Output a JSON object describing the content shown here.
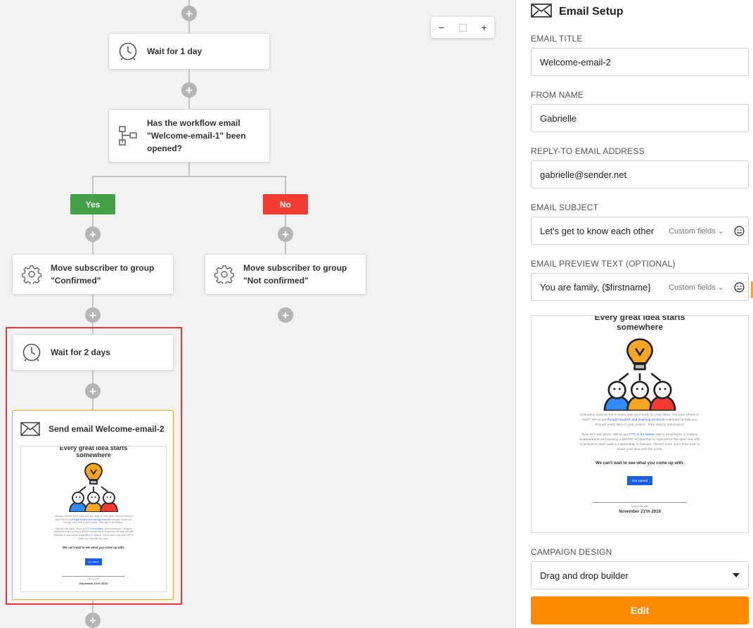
{
  "canvas": {
    "zoom_controls": {
      "minus": "−",
      "plus": "+"
    },
    "nodes": {
      "wait1": "Wait for 1 day",
      "condition": "Has the workflow email \"Welcome-email-1\" been opened?",
      "move_yes": "Move subscriber to group \"Confirmed\"",
      "move_no": "Move subscriber to group \"Not confirmed\"",
      "wait2": "Wait for 2 days",
      "send_email": "Send email Welcome-email-2"
    },
    "branches": {
      "yes": "Yes",
      "no": "No"
    },
    "plus_symbol": "+"
  },
  "preview": {
    "title": "Every great idea starts somewhere",
    "body1_before": "Company Science list in under way and ready for your ideas. Not sure where to start? We've got ",
    "body1_link": "thought leaders and inspiring products",
    "body1_after": " examples to help you through every idea of your project - from start to submission.",
    "body2_before": "Now let's talk about. We've got ",
    "body2_link": "YTG to be stated",
    "body2_after": ". We're traveling to Company headquarters and winning a $50000 scholarship to experience the open sea with scientists or even added a spaceship in Mission. There's even more than ever to share your idea with the world.",
    "tagline": "We can't wait to see what you come up with.",
    "cta": "Get started",
    "footer_small": "Submit an idea",
    "date": "November 21'th 2019"
  },
  "panel": {
    "title": "Email Setup",
    "email_title": {
      "label": "EMAIL TITLE",
      "value": "Welcome-email-2"
    },
    "from_name": {
      "label": "FROM NAME",
      "value": "Gabrielle"
    },
    "reply_to": {
      "label": "REPLY-TO EMAIL ADDRESS",
      "value": "gabrielle@sender.net"
    },
    "subject": {
      "label": "EMAIL SUBJECT",
      "value": "Let's get to know each other",
      "custom_fields": "Custom fields"
    },
    "preview_text": {
      "label": "EMAIL PREVIEW TEXT (OPTIONAL)",
      "value": "You are family, {$firstname}",
      "custom_fields": "Custom fields"
    },
    "campaign_design": {
      "label": "CAMPAIGN DESIGN",
      "value": "Drag and drop builder"
    },
    "edit_button": "Edit"
  },
  "colors": {
    "yes": "#43a047",
    "no": "#f23b31",
    "accent": "#ff8a00",
    "highlight": "#e53935",
    "selected_border": "#f6a623"
  },
  "icons": [
    "clock-icon",
    "workflow-condition-icon",
    "gear-icon",
    "envelope-icon",
    "smiley-icon",
    "chevron-down-icon",
    "lightbulb-icon"
  ]
}
